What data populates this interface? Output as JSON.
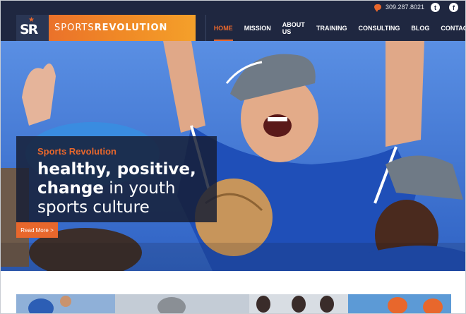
{
  "topbar": {
    "phone": "309.287.8021",
    "chat_icon": "chat-bubble-icon",
    "twitter_icon": "twitter-icon",
    "facebook_icon": "facebook-icon",
    "twitter_glyph": "t",
    "facebook_glyph": "f"
  },
  "logo": {
    "monogram": "SR",
    "text_light": "SPORTS",
    "text_bold": "REVOLUTION"
  },
  "nav": {
    "items": [
      {
        "label": "HOME"
      },
      {
        "label": "MISSION"
      },
      {
        "label": "ABOUT US"
      },
      {
        "label": "TRAINING"
      },
      {
        "label": "CONSULTING"
      },
      {
        "label": "BLOG"
      },
      {
        "label": "CONTACT"
      }
    ],
    "active_index": 0
  },
  "hero": {
    "kicker": "Sports Revolution",
    "line1": "healthy, positive,",
    "line2_bold": "change",
    "line2_rest": " in youth",
    "line3": "sports culture",
    "cta": "Read More >"
  },
  "colors": {
    "accent": "#e8672c",
    "navy": "#1f2740",
    "sky": "#3b6fd0",
    "jersey": "#1f4fb8"
  }
}
